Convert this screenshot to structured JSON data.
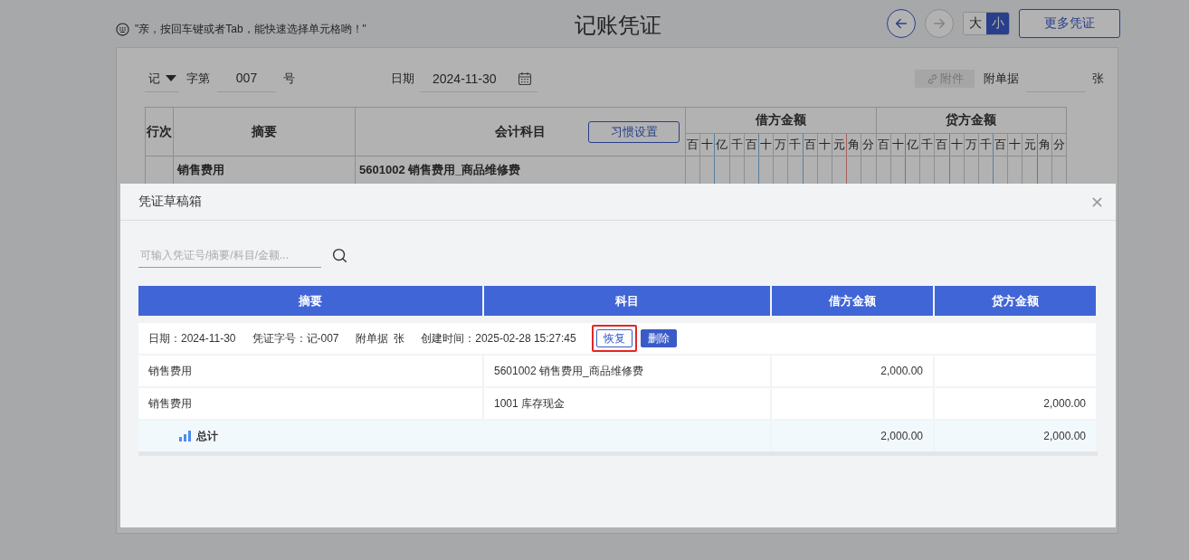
{
  "header": {
    "hint": "\"亲，按回车键或者Tab，能快速选择单元格哟！\"",
    "title": "记账凭证",
    "nav": [
      {
        "kind": "back",
        "disabled": false
      },
      {
        "kind": "forward",
        "disabled": true
      }
    ],
    "size_toggle": [
      {
        "label": "大",
        "selected": false
      },
      {
        "label": "小",
        "selected": true
      }
    ],
    "more_button": "更多凭证"
  },
  "voucher": {
    "word": "记",
    "word_label": "字第",
    "number": "007",
    "number_suffix": "号",
    "date_label": "日期",
    "date": "2024-11-30",
    "attachment_button": {
      "label": "附件",
      "disabled": true
    },
    "attached_label": "附单据",
    "attached_unit": "张",
    "table": {
      "line_header": "行次",
      "summary_header": "摘要",
      "account_header": "会计科目",
      "settings_button": "习惯设置",
      "debit_header": "借方金额",
      "credit_header": "贷方金额",
      "debit_units": [
        "百",
        "十",
        "亿",
        "千",
        "百",
        "十",
        "万",
        "千",
        "百",
        "十",
        "元",
        "角",
        "分"
      ],
      "credit_units": [
        "百",
        "十",
        "亿",
        "千",
        "百",
        "十",
        "万",
        "千",
        "百",
        "十",
        "元",
        "角",
        "分"
      ],
      "rows": [
        {
          "summary": "销售费用",
          "account": "5601002 销售费用_商品维修费"
        }
      ]
    }
  },
  "dialog": {
    "title": "凭证草稿箱",
    "search": {
      "placeholder": "可输入凭证号/摘要/科目/金额..."
    },
    "columns": [
      "摘要",
      "科目",
      "借方金额",
      "贷方金额"
    ],
    "drafts": [
      {
        "meta": [
          "日期：2024-11-30",
          "凭证字号：记-007",
          "附单据  张",
          "创建时间：2025-02-28 15:27:45"
        ],
        "actions": [
          {
            "label": "恢复",
            "kind": "outline",
            "highlighted": true
          },
          {
            "label": "删除",
            "kind": "solid",
            "highlighted": false
          }
        ],
        "entries": [
          {
            "summary": "销售费用",
            "account": "5601002 销售费用_商品维修费",
            "debit": "2,000.00"
          },
          {
            "summary": "销售费用",
            "account": "1001 库存现金",
            "credit": "2,000.00"
          }
        ],
        "total": {
          "label": "总计",
          "debit": "2,000.00",
          "credit": "2,000.00"
        }
      }
    ]
  }
}
